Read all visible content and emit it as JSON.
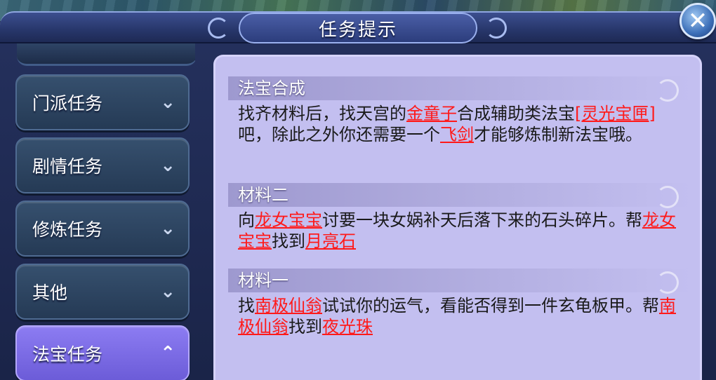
{
  "window": {
    "title": "任务提示",
    "close_label": "✕"
  },
  "menu": {
    "items": [
      {
        "label": "门派任务",
        "chevron": "⌄",
        "active": false
      },
      {
        "label": "剧情任务",
        "chevron": "⌄",
        "active": false
      },
      {
        "label": "修炼任务",
        "chevron": "⌄",
        "active": false
      },
      {
        "label": "其他",
        "chevron": "⌄",
        "active": false
      },
      {
        "label": "法宝任务",
        "chevron": "⌃",
        "active": true
      }
    ]
  },
  "sections": [
    {
      "header": "法宝合成",
      "parts": [
        {
          "t": "找齐材料后，找天宫的"
        },
        {
          "t": "金童子",
          "hl": true
        },
        {
          "t": "合成辅助类法宝"
        },
        {
          "t": "[灵光宝匣]",
          "hl": true
        },
        {
          "t": "吧，除此之外你还需要一个"
        },
        {
          "t": "飞剑",
          "hl": true
        },
        {
          "t": "才能够炼制新法宝哦。"
        }
      ]
    },
    {
      "header": "材料二",
      "parts": [
        {
          "t": "向"
        },
        {
          "t": "龙女宝宝",
          "hl": true
        },
        {
          "t": "讨要一块女娲补天后落下来的石头碎片。帮"
        },
        {
          "t": "龙女宝宝",
          "hl": true
        },
        {
          "t": "找到"
        },
        {
          "t": "月亮石",
          "hl": true
        }
      ]
    },
    {
      "header": "材料一",
      "parts": [
        {
          "t": "找"
        },
        {
          "t": "南极仙翁",
          "hl": true
        },
        {
          "t": "试试你的运气，看能否得到一件玄龟板甲。帮"
        },
        {
          "t": "南极仙翁",
          "hl": true
        },
        {
          "t": "找到"
        },
        {
          "t": "夜光珠",
          "hl": true
        }
      ]
    }
  ],
  "colors": {
    "highlight": "#ff1a1a",
    "panel_bg": "#c3bff0",
    "active_tab": "#7c6ce6"
  }
}
